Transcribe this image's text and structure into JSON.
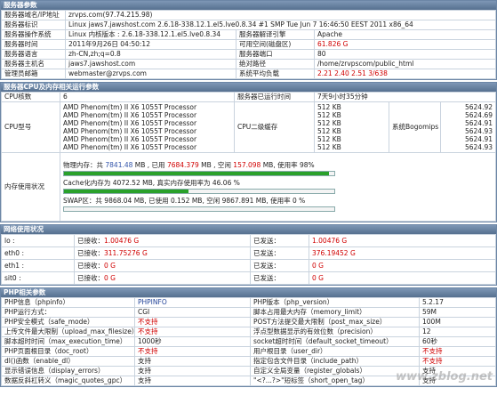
{
  "server": {
    "header": "服务器参数",
    "rows": [
      {
        "l": "服务器域名/IP地址",
        "v": "zrvps.com(97.74.215.98)"
      },
      {
        "l": "服务器标识",
        "v": "Linux jaws7.jawshost.com 2.6.18-338.12.1.el5.lve0.8.34 #1 SMP Tue Jun 7 16:46:50 EEST 2011 x86_64"
      }
    ],
    "pairs": [
      {
        "l1": "服务器操作系统",
        "v1": "Linux  内核版本 : 2.6.18-338.12.1.el5.lve0.8.34",
        "l2": "服务器解译引擎",
        "v2": "Apache"
      },
      {
        "l1": "服务器时间",
        "v1": "2011年9月26日 04:50:12",
        "l2": "可用空间(磁盘区)",
        "v2": "61.826 G"
      },
      {
        "l1": "服务器语言",
        "v1": "zh-CN,zh;q=0.8",
        "l2": "服务器端口",
        "v2": "80"
      },
      {
        "l1": "服务器主机名",
        "v1": "jaws7.jawshost.com",
        "l2": "绝对路径",
        "v2": "/home/zrvpscom/public_html"
      },
      {
        "l1": "管理员邮箱",
        "v1": "webmaster@zrvps.com",
        "l2": "系统平均负载",
        "v2": "2.21  2.40  2.51  3/638"
      }
    ]
  },
  "cpu": {
    "header": "服务器CPU及内存相关运行参数",
    "cores_label": "CPU核数",
    "cores_value": "6",
    "uptime_label": "服务器已运行时间",
    "uptime_value": "7天9小时35分钟",
    "model_label": "CPU型号",
    "models": [
      "AMD Phenom(tm) II X6 1055T Processor",
      "AMD Phenom(tm) II X6 1055T Processor",
      "AMD Phenom(tm) II X6 1055T Processor",
      "AMD Phenom(tm) II X6 1055T Processor",
      "AMD Phenom(tm) II X6 1055T Processor",
      "AMD Phenom(tm) II X6 1055T Processor"
    ],
    "cache_label": "CPU二级缓存",
    "caches": [
      "512 KB",
      "512 KB",
      "512 KB",
      "512 KB",
      "512 KB",
      "512 KB"
    ],
    "bogo_label": "系统Bogomips",
    "bogos": [
      "5624.92",
      "5624.69",
      "5624.91",
      "5624.93",
      "5624.91",
      "5624.93"
    ],
    "mem_label": "内存使用状况",
    "phys_prefix": "物理内存：共 ",
    "phys_total": "7841.48",
    "phys_used_prefix": " MB , 已用 ",
    "phys_used": "7684.379",
    "phys_free_prefix": " MB , 空闲 ",
    "phys_free": "157.098",
    "phys_rate_text": " MB, 使用率 98%",
    "phys_ratio": 0.98,
    "cache_text": "Cache化内存为 4072.52 MB, 真实内存使用率为 46.06 %",
    "cache_ratio": 0.4606,
    "swap_text": "SWAP区：共 9868.04 MB, 已使用 0.152 MB, 空闲 9867.891 MB, 使用率 0 %",
    "swap_ratio": 0.0
  },
  "network": {
    "header": "网络使用状况",
    "recv_label": "已接收：",
    "sent_label": "已发送：",
    "rows": [
      {
        "name": "lo :",
        "recv": "1.00476 G",
        "sent": "1.00476 G"
      },
      {
        "name": "eth0 :",
        "recv": "311.75276 G",
        "sent": "376.19452 G"
      },
      {
        "name": "eth1 :",
        "recv": "0 G",
        "sent": "0 G"
      },
      {
        "name": "sit0 :",
        "recv": "0 G",
        "sent": "0 G"
      }
    ]
  },
  "php": {
    "header": "PHP相关参数",
    "rows": [
      {
        "l1": "PHP信息（phpinfo）",
        "v1": "PHPINFO",
        "l2": "PHP版本（php_version）",
        "v2": "5.2.17"
      },
      {
        "l1": "PHP运行方式：",
        "v1": "CGI",
        "l2": "脚本占用最大内存（memory_limit）",
        "v2": "59M"
      },
      {
        "l1": "PHP安全模式（safe_mode）",
        "v1": "不支持",
        "l2": "POST方法提交最大限制（post_max_size）",
        "v2": "100M"
      },
      {
        "l1": "上传文件最大限制（upload_max_filesize）",
        "v1": "不支持",
        "l2": "浮点型数据显示的有效位数（precision）",
        "v2": "12"
      },
      {
        "l1": "脚本超时时间（max_execution_time）",
        "v1": "1000秒",
        "l2": "socket超时时间（default_socket_timeout）",
        "v2": "60秒"
      },
      {
        "l1": "PHP页面根目录（doc_root）",
        "v1": "不支持",
        "l2": "用户根目录（user_dir）",
        "v2": "不支持"
      },
      {
        "l1": "dl()函数（enable_dl）",
        "v1": "支持",
        "l2": "指定包含文件目录（include_path）",
        "v2": "不支持"
      },
      {
        "l1": "显示错误信息（display_errors）",
        "v1": "支持",
        "l2": "自定义全局变量（register_globals）",
        "v2": "支持"
      },
      {
        "l1": "数据反斜杠转义（magic_quotes_gpc）",
        "v1": "支持",
        "l2": "\"<?...?>\"短标签（short_open_tag）",
        "v2": "支持"
      }
    ],
    "red_values": [
      "不支持"
    ]
  },
  "watermark": "www.zblog.net",
  "colors": {
    "header_bg": "#56708f",
    "bar_fill": "#2aa12a",
    "accent_red": "#d00000",
    "accent_blue": "#3355aa"
  }
}
